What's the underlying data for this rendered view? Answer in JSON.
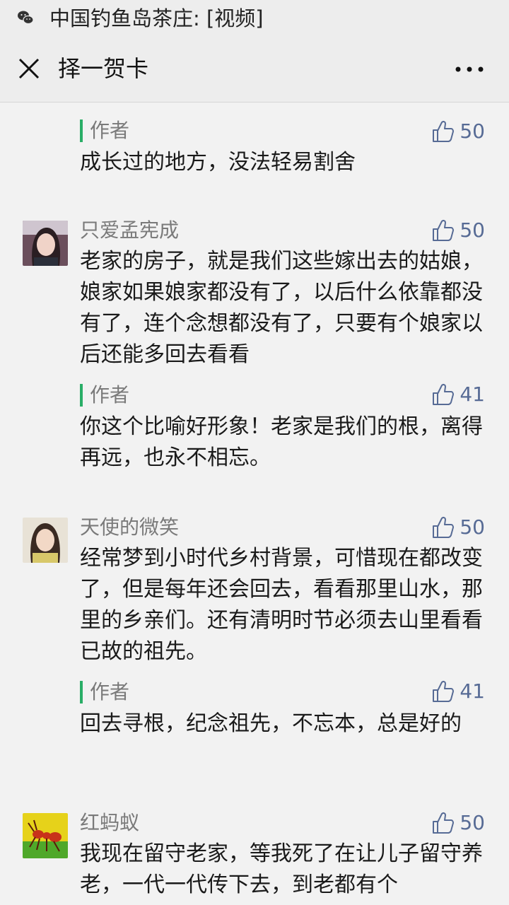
{
  "statusbar": {
    "icon": "wechat-icon",
    "notification": "中国钓鱼岛茶庄: [视频]"
  },
  "navbar": {
    "close_icon": "close-icon",
    "title": "择一贺卡",
    "more_icon": "more-icon"
  },
  "colors": {
    "like": "#576b95",
    "reply_bar": "#2aae67",
    "nick": "#7a7a7a"
  },
  "comments": [
    {
      "reply_label": "作者",
      "text": "成长过的地方，没法轻易割舍",
      "likes": "50"
    },
    {
      "nick": "只爱孟宪成",
      "text": "老家的房子，就是我们这些嫁出去的姑娘，娘家如果娘家都没有了，以后什么依靠都没有了，连个念想都没有了，只要有个娘家以后还能多回去看看",
      "likes": "50",
      "reply": {
        "label": "作者",
        "text": "你这个比喻好形象！老家是我们的根，离得再远，也永不相忘。",
        "likes": "41"
      }
    },
    {
      "nick": "天使的微笑",
      "text": "经常梦到小时代乡村背景，可惜现在都改变了，但是每年还会回去，看看那里山水，那里的乡亲们。还有清明时节必须去山里看看已故的祖先。",
      "likes": "50",
      "reply": {
        "label": "作者",
        "text": "回去寻根，纪念祖先，不忘本，总是好的",
        "likes": "41"
      }
    },
    {
      "nick": "红蚂蚁",
      "text": "我现在留守老家，等我死了在让儿子留守养老，一代一代传下去，到老都有个",
      "likes": "50"
    }
  ]
}
